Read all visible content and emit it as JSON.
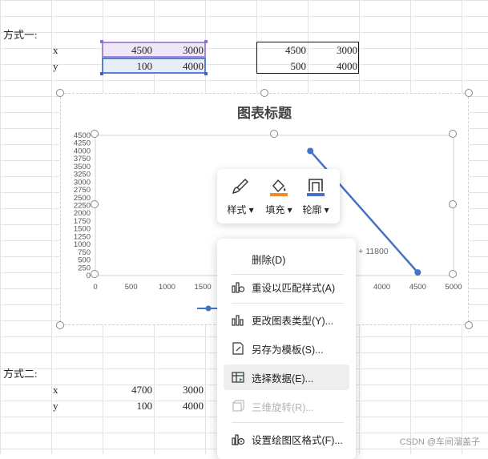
{
  "sheet": {
    "section1_label": "方式一:",
    "section2_label": "方式二:",
    "row_x": "x",
    "row_y": "y",
    "table1": {
      "x": [
        "4500",
        "3000"
      ],
      "y": [
        "100",
        "4000"
      ]
    },
    "table2": {
      "x": [
        "4500",
        "3000"
      ],
      "y": [
        "500",
        "4000"
      ]
    },
    "table3": {
      "x": [
        "4700",
        "3000"
      ],
      "y": [
        "100",
        "4000"
      ]
    }
  },
  "chart_data": {
    "type": "scatter",
    "title": "图表标题",
    "x_ticks": [
      "0",
      "500",
      "1000",
      "1500",
      "2000",
      "2500",
      "3000",
      "3500",
      "4000",
      "4500",
      "5000"
    ],
    "y_ticks": [
      "0",
      "250",
      "500",
      "750",
      "1000",
      "1250",
      "1500",
      "1750",
      "2000",
      "2250",
      "2500",
      "2750",
      "3000",
      "3250",
      "3500",
      "3750",
      "4000",
      "4250",
      "4500"
    ],
    "xlim": [
      0,
      5000
    ],
    "ylim": [
      0,
      4500
    ],
    "series": [
      {
        "points": [
          {
            "x": 3000,
            "y": 4000
          },
          {
            "x": 4500,
            "y": 100
          }
        ],
        "color": "#4472c4"
      }
    ],
    "trendline_label": "x + 11800"
  },
  "toolbar": {
    "items": [
      {
        "label": "样式",
        "icon": "brush-icon"
      },
      {
        "label": "填充",
        "icon": "fill-bucket-icon"
      },
      {
        "label": "轮廓",
        "icon": "outline-icon"
      }
    ],
    "accent_fill": "#f08a24",
    "accent_outline": "#4472c4"
  },
  "context_menu": {
    "items": [
      {
        "label": "删除(D)",
        "icon": "",
        "disabled": false
      },
      {
        "label": "重设以匹配样式(A)",
        "icon": "reset-style-icon",
        "disabled": false
      },
      {
        "label": "更改图表类型(Y)...",
        "icon": "chart-type-icon",
        "disabled": false
      },
      {
        "label": "另存为模板(S)...",
        "icon": "save-template-icon",
        "disabled": false
      },
      {
        "label": "选择数据(E)...",
        "icon": "select-data-icon",
        "disabled": false
      },
      {
        "label": "三维旋转(R)...",
        "icon": "3d-rotate-icon",
        "disabled": true
      },
      {
        "label": "设置绘图区格式(F)...",
        "icon": "format-plot-area-icon",
        "disabled": false
      }
    ]
  },
  "watermark": "CSDN @车间溜盖子"
}
